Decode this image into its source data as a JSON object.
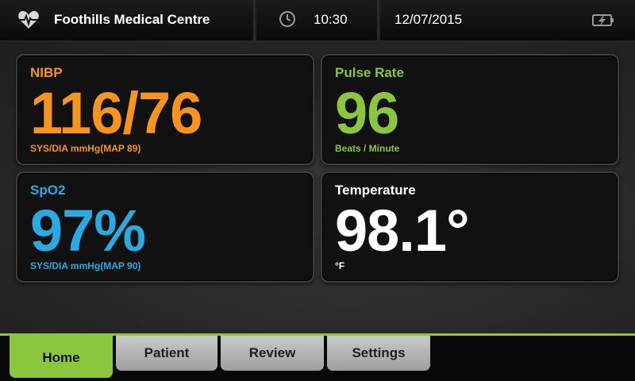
{
  "header": {
    "facility": "Foothills Medical Centre",
    "time": "10:30",
    "date": "12/07/2015",
    "icons": [
      "heart-ecg-icon",
      "clock-icon",
      "battery-charging-icon"
    ]
  },
  "vitals": {
    "nibp": {
      "title": "NIBP",
      "value": "116/76",
      "sub": "SYS/DIA mmHg(MAP 89)",
      "color": "#f7941d"
    },
    "pulse": {
      "title": "Pulse Rate",
      "value": "96",
      "sub": "Beats / Minute",
      "color": "#8cc63f"
    },
    "spo2": {
      "title": "SpO2",
      "value": "97%",
      "sub": "SYS/DIA mmHg(MAP 90)",
      "color": "#29abe2"
    },
    "temp": {
      "title": "Temperature",
      "value": "98.1°",
      "sub": "°F",
      "color": "#ffffff"
    }
  },
  "nav": {
    "tabs": [
      "Home",
      "Patient",
      "Review",
      "Settings"
    ],
    "active": "Home",
    "accent": "#8cc63f"
  }
}
